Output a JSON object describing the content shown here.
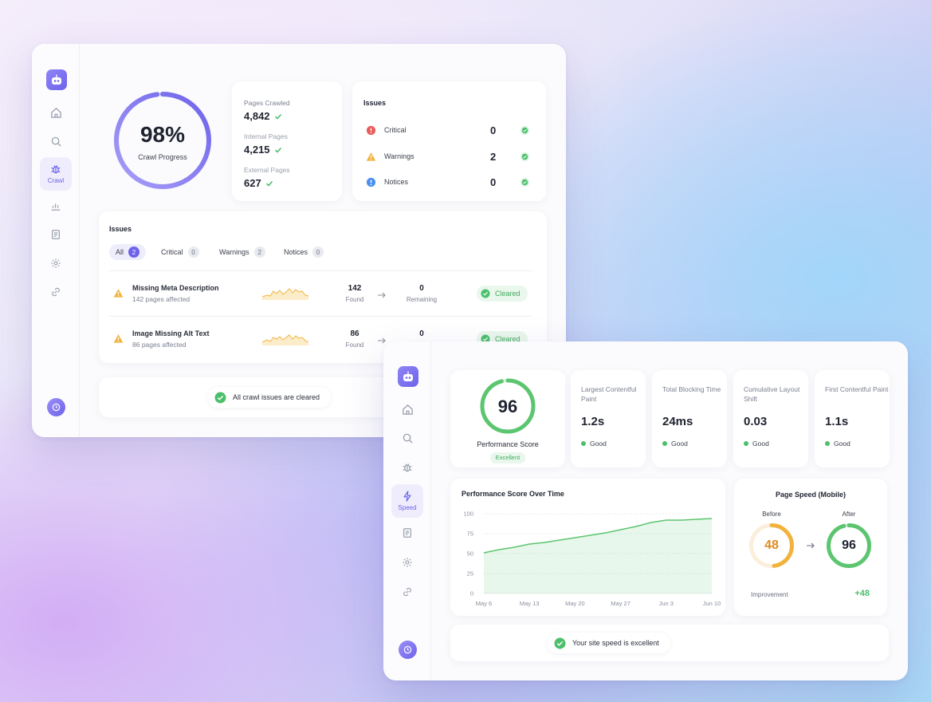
{
  "window1": {
    "sidebar": {
      "active_label": "Crawl",
      "items": [
        "home-icon",
        "search-icon",
        "bug-icon",
        "chart-icon",
        "document-icon",
        "settings-icon",
        "link-icon"
      ]
    },
    "crawl_progress": {
      "value": "98%",
      "label": "Crawl Progress",
      "fraction": 0.98
    },
    "stats": [
      {
        "label": "Pages Crawled",
        "value": "4,842"
      },
      {
        "label": "Internal Pages",
        "value": "4,215"
      },
      {
        "label": "External Pages",
        "value": "627"
      }
    ],
    "issues_summary": {
      "title": "Issues",
      "rows": [
        {
          "label": "Critical",
          "count": "0",
          "color": "#ea5a5a"
        },
        {
          "label": "Warnings",
          "count": "2",
          "color": "#f2b33d"
        },
        {
          "label": "Notices",
          "count": "0",
          "color": "#4c8ff0"
        }
      ]
    },
    "issues_list": {
      "title": "Issues",
      "tabs": [
        {
          "label": "All",
          "count": "2"
        },
        {
          "label": "Critical",
          "count": "0"
        },
        {
          "label": "Warnings",
          "count": "2"
        },
        {
          "label": "Notices",
          "count": "0"
        }
      ],
      "rows": [
        {
          "title": "Missing Meta Description",
          "subtitle": "142 pages affected",
          "found": "142",
          "found_label": "Found",
          "remaining": "0",
          "remaining_label": "Remaining",
          "status": "Cleared"
        },
        {
          "title": "Image Missing Alt Text",
          "subtitle": "86 pages affected",
          "found": "86",
          "found_label": "Found",
          "remaining": "0",
          "status": "Cleared"
        }
      ]
    },
    "footer_message": "All crawl issues are cleared"
  },
  "window2": {
    "sidebar": {
      "active_label": "Speed",
      "items": [
        "home-icon",
        "search-icon",
        "bug-icon",
        "bolt-icon",
        "document-icon",
        "settings-icon",
        "link-icon"
      ]
    },
    "performance": {
      "score": "96",
      "label": "Performance Score",
      "badge": "Excellent",
      "fraction": 0.96
    },
    "metrics": [
      {
        "title": "Largest Contentful Paint",
        "value": "1.2s",
        "status": "Good"
      },
      {
        "title": "Total Blocking Time",
        "value": "24ms",
        "status": "Good"
      },
      {
        "title": "Cumulative Layout Shift",
        "value": "0.03",
        "status": "Good"
      },
      {
        "title": "First Contentful Paint",
        "value": "1.1s",
        "status": "Good"
      }
    ],
    "page_speed": {
      "title": "Page Speed (Mobile)",
      "before_label": "Before",
      "before": "48",
      "before_fraction": 0.48,
      "after_label": "After",
      "after": "96",
      "after_fraction": 0.96,
      "improvement_label": "Improvement",
      "improvement": "+48"
    },
    "footer_message": "Your site speed is excellent"
  },
  "chart_data": {
    "type": "area",
    "title": "Performance Score Over Time",
    "xlabel": "",
    "ylabel": "",
    "x_ticks": [
      "May 6",
      "May 13",
      "May 20",
      "May 27",
      "Jun 3",
      "Jun 10"
    ],
    "y_ticks": [
      "100",
      "75",
      "50",
      "25",
      "0"
    ],
    "ylim": [
      0,
      100
    ],
    "grid": true,
    "x": [
      "May 6",
      "May 8",
      "May 10",
      "May 13",
      "May 15",
      "May 17",
      "May 20",
      "May 22",
      "May 24",
      "May 27",
      "May 29",
      "Jun 1",
      "Jun 3",
      "Jun 5",
      "Jun 8",
      "Jun 10"
    ],
    "values": [
      51,
      55,
      58,
      62,
      64,
      67,
      70,
      73,
      76,
      80,
      84,
      89,
      92,
      92,
      93,
      94
    ],
    "color": "#5cc56f"
  },
  "colors": {
    "accent": "#6d63ea",
    "good": "#4cbf6b",
    "warning": "#f2b33d",
    "critical": "#ea5a5a",
    "notice": "#4c8ff0"
  }
}
